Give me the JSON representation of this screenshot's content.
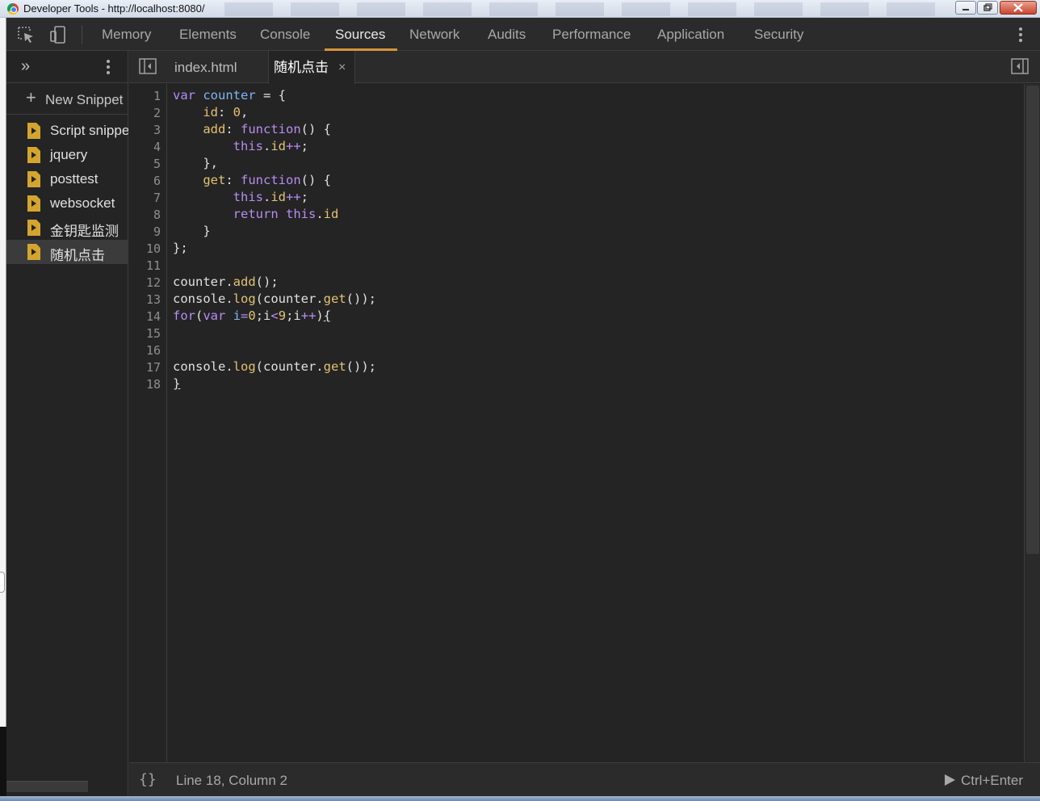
{
  "window": {
    "title": "Developer Tools - http://localhost:8080/"
  },
  "toolbar": {
    "tabs": [
      {
        "label": "Memory"
      },
      {
        "label": "Elements"
      },
      {
        "label": "Console"
      },
      {
        "label": "Sources",
        "active": true
      },
      {
        "label": "Network"
      },
      {
        "label": "Audits"
      },
      {
        "label": "Performance"
      },
      {
        "label": "Application"
      },
      {
        "label": "Security"
      }
    ],
    "accent_color": "#d3943a"
  },
  "navigator": {
    "more_glyph": "»",
    "new_snippet_label": "New Snippet",
    "snippets": [
      {
        "label": "Script snippet"
      },
      {
        "label": "jquery"
      },
      {
        "label": "posttest"
      },
      {
        "label": "websocket"
      },
      {
        "label": "金钥匙监测"
      },
      {
        "label": "随机点击",
        "selected": true
      }
    ]
  },
  "editor": {
    "tabs": [
      {
        "label": "index.html"
      },
      {
        "label": "随机点击",
        "active": true,
        "close_glyph": "×"
      }
    ],
    "line_numbers": [
      "1",
      "2",
      "3",
      "4",
      "5",
      "6",
      "7",
      "8",
      "9",
      "10",
      "11",
      "12",
      "13",
      "14",
      "15",
      "16",
      "17",
      "18"
    ]
  },
  "status": {
    "braces": "{}",
    "position": "Line 18, Column 2",
    "run_label": "Ctrl+Enter"
  },
  "code_colors": {
    "keyword": "#b68ef2",
    "variable": "#7eb6f6",
    "property": "#e3c272",
    "default": "#e0e0e0"
  }
}
